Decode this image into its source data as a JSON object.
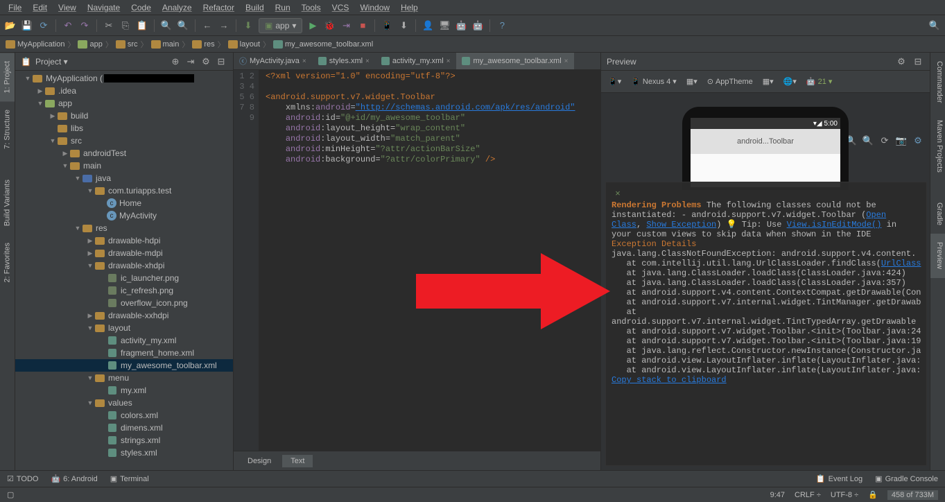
{
  "menu": [
    "File",
    "Edit",
    "View",
    "Navigate",
    "Code",
    "Analyze",
    "Refactor",
    "Build",
    "Run",
    "Tools",
    "VCS",
    "Window",
    "Help"
  ],
  "toolbar": {
    "app_label": "app",
    "run_config_prefix": "[]"
  },
  "breadcrumbs": [
    "MyApplication",
    "app",
    "src",
    "main",
    "res",
    "layout",
    "my_awesome_toolbar.xml"
  ],
  "project_panel": {
    "title": "Project",
    "root": "MyApplication (",
    "nodes": {
      "idea": ".idea",
      "app": "app",
      "build": "build",
      "libs": "libs",
      "src": "src",
      "androidTest": "androidTest",
      "main": "main",
      "java": "java",
      "pkg": "com.turiapps.test",
      "home": "Home",
      "activity": "MyActivity",
      "res": "res",
      "d_hdpi": "drawable-hdpi",
      "d_mdpi": "drawable-mdpi",
      "d_xhdpi": "drawable-xhdpi",
      "ic_launcher": "ic_launcher.png",
      "ic_refresh": "ic_refresh.png",
      "overflow": "overflow_icon.png",
      "d_xxhdpi": "drawable-xxhdpi",
      "layout": "layout",
      "activity_my": "activity_my.xml",
      "fragment": "fragment_home.xml",
      "my_toolbar": "my_awesome_toolbar.xml",
      "menu": "menu",
      "my_xml": "my.xml",
      "values": "values",
      "colors": "colors.xml",
      "dimens": "dimens.xml",
      "strings": "strings.xml",
      "styles": "styles.xml"
    }
  },
  "tabs": [
    "MyActivity.java",
    "styles.xml",
    "activity_my.xml",
    "my_awesome_toolbar.xml"
  ],
  "code": {
    "line_nums": "1\n2\n3\n4\n5\n6\n7\n8\n9",
    "xml_decl": "<?xml version=\"1.0\" encoding=\"utf-8\"?>",
    "tag_open": "<android.support.v7.widget.Toolbar",
    "xmlns_label": "xmlns:",
    "android": "android",
    "xmlns_val": "\"http://schemas.android.com/apk/res/android\"",
    "id_label": ":id=",
    "id_val": "\"@+id/my_awesome_toolbar\"",
    "lh_label": ":layout_height=",
    "lh_val": "\"wrap_content\"",
    "lw_label": ":layout_width=",
    "lw_val": "\"match_parent\"",
    "mh_label": ":minHeight=",
    "mh_val": "\"?attr/actionBarSize\"",
    "bg_label": ":background=",
    "bg_val": "\"?attr/colorPrimary\"",
    "close": " />"
  },
  "editor_tabs": {
    "design": "Design",
    "text": "Text"
  },
  "preview": {
    "title": "Preview",
    "device": "Nexus 4",
    "theme": "AppTheme",
    "api": "21",
    "time": "5:00",
    "widget_label": "android...Toolbar"
  },
  "error": {
    "title": "Rendering Problems",
    "msg": "The following classes could not be instantiated:",
    "class_name": "- android.support.v7.widget.Toolbar (",
    "open_class": "Open Class",
    "comma": ", ",
    "show_exc": "Show Exception",
    "close_paren": ")",
    "tip_pre": " Tip: Use ",
    "tip_link": "View.isInEditMode()",
    "tip_post": " in your custom views to skip data when shown in the IDE",
    "exc_title": "Exception Details",
    "stack": "java.lang.ClassNotFoundException: android.support.v4.content.\n   at com.intellij.util.lang.UrlClassLoader.findClass(",
    "url_class_link": "UrlClass",
    "stack2": "   at java.lang.ClassLoader.loadClass(ClassLoader.java:424)\n   at java.lang.ClassLoader.loadClass(ClassLoader.java:357)\n   at android.support.v4.content.ContextCompat.getDrawable(Con\n   at android.support.v7.internal.widget.TintManager.getDrawab\n   at\nandroid.support.v7.internal.widget.TintTypedArray.getDrawable\n   at android.support.v7.widget.Toolbar.<init>(Toolbar.java:24\n   at android.support.v7.widget.Toolbar.<init>(Toolbar.java:19\n   at java.lang.reflect.Constructor.newInstance(Constructor.ja\n   at android.view.LayoutInflater.inflate(LayoutInflater.java:\n   at android.view.LayoutInflater.inflate(LayoutInflater.java:",
    "copy": "Copy stack to clipboard"
  },
  "left_tools": {
    "project": "1: Project",
    "structure": "7: Structure",
    "build_variants": "Build Variants",
    "favorites": "2: Favorites"
  },
  "right_tools": {
    "commander": "Commander",
    "maven": "Maven Projects",
    "gradle": "Gradle",
    "preview": "Preview"
  },
  "bottom": {
    "todo": "TODO",
    "android": "6: Android",
    "terminal": "Terminal",
    "event_log": "Event Log",
    "gradle_console": "Gradle Console"
  },
  "status": {
    "pos": "9:47",
    "crlf": "CRLF",
    "enc": "UTF-8",
    "mem": "458 of 733M",
    "lock": "a"
  }
}
